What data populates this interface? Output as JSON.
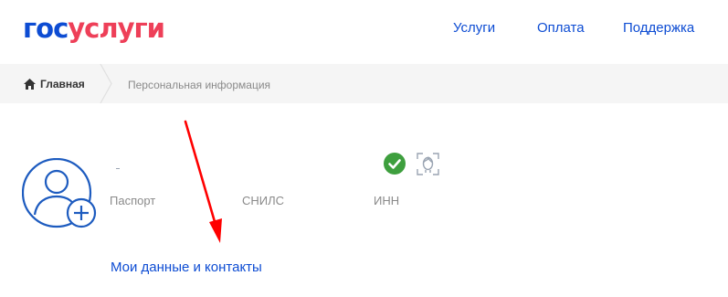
{
  "header": {
    "logo_part1": "гос",
    "logo_part2": "услуги",
    "nav": [
      "Услуги",
      "Оплата",
      "Поддержка"
    ]
  },
  "breadcrumb": {
    "home": "Главная",
    "current": "Персональная информация"
  },
  "profile": {
    "documents": [
      "Паспорт",
      "СНИЛС",
      "ИНН"
    ],
    "contacts_link": "Мои данные и контакты"
  },
  "colors": {
    "brand_blue": "#0d4cd3",
    "brand_red": "#ee3f58",
    "success_green": "#3e9f3e",
    "avatar_blue": "#1d5bbf",
    "annotation_red": "#ff0000"
  },
  "icons": [
    "home-icon",
    "verified-check-icon",
    "biometrics-face-icon",
    "avatar-add-icon"
  ]
}
